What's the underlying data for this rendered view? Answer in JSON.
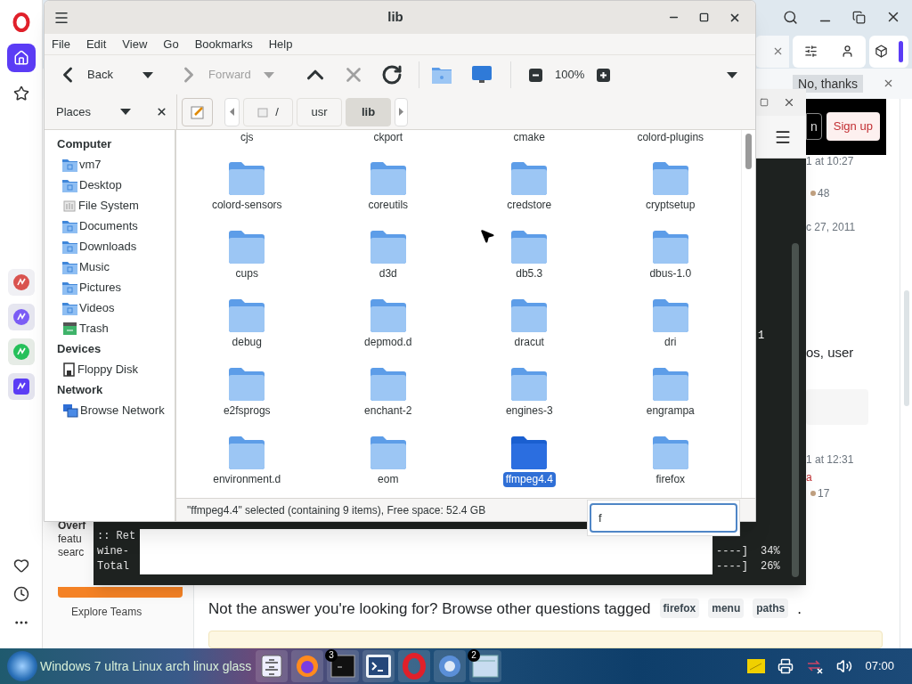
{
  "browser": {
    "sidebar_top": [
      {
        "kind": "opera",
        "selected": false
      },
      {
        "kind": "home",
        "selected": true
      },
      {
        "kind": "star",
        "selected": false
      }
    ],
    "sidebar_apps": [
      {
        "kind": "paint"
      },
      {
        "kind": "messenger"
      },
      {
        "kind": "whatsapp"
      },
      {
        "kind": "music"
      }
    ],
    "sidebar_bottom": [
      {
        "kind": "heart"
      },
      {
        "kind": "clock"
      },
      {
        "kind": "more"
      }
    ],
    "popup": {
      "button": "No, thanks"
    },
    "header": {
      "login_fragment": "n",
      "signup": "Sign up"
    },
    "left_column": {
      "lines": [
        "Overf",
        "featu",
        "searc"
      ],
      "link": "Explore Teams"
    },
    "question": {
      "text": "Not the answer you're looking for? Browse other questions tagged",
      "tags": [
        "firefox",
        "menu",
        "paths"
      ],
      "end": "."
    },
    "right_column": {
      "time_1": "1 at 10:27",
      "score_1": "48",
      "date": "c 27, 2011",
      "snippet": "os, user",
      "time_2": "1 at 12:31",
      "author_2": "a",
      "score_2": "17"
    }
  },
  "terminal": {
    "fragment": "1",
    "rows": [
      {
        "left": ":: Ret"
      },
      {
        "left": "wine-",
        "bar": "----]",
        "percent": "34%"
      },
      {
        "left": "Total",
        "bar": "----]",
        "percent": "26%"
      }
    ]
  },
  "file_manager": {
    "title": "lib",
    "menu": [
      "File",
      "Edit",
      "View",
      "Go",
      "Bookmarks",
      "Help"
    ],
    "nav": [
      {
        "kind": "back",
        "label": "Back",
        "disabled": false
      },
      {
        "kind": "forward",
        "label": "Forward",
        "disabled": true
      }
    ],
    "tools": [
      {
        "kind": "up",
        "disabled": false
      },
      {
        "kind": "stop",
        "disabled": true
      },
      {
        "kind": "reload",
        "disabled": false
      }
    ],
    "zoom": "100%",
    "places": "Places",
    "path": [
      {
        "label": "/",
        "kind": "root",
        "selected": false
      },
      {
        "label": "usr",
        "kind": "dir",
        "selected": false
      },
      {
        "label": "lib",
        "kind": "dir",
        "selected": true
      }
    ],
    "sidebar": [
      {
        "heading": "Computer",
        "items": [
          {
            "label": "vm7",
            "kind": "home"
          },
          {
            "label": "Desktop",
            "kind": "desktop"
          },
          {
            "label": "File System",
            "kind": "drive"
          },
          {
            "label": "Documents",
            "kind": "documents"
          },
          {
            "label": "Downloads",
            "kind": "downloads"
          },
          {
            "label": "Music",
            "kind": "music"
          },
          {
            "label": "Pictures",
            "kind": "pictures"
          },
          {
            "label": "Videos",
            "kind": "videos"
          },
          {
            "label": "Trash",
            "kind": "trash"
          }
        ]
      },
      {
        "heading": "Devices",
        "items": [
          {
            "label": "Floppy Disk",
            "kind": "floppy"
          }
        ]
      },
      {
        "heading": "Network",
        "items": [
          {
            "label": "Browse Network",
            "kind": "network"
          }
        ]
      }
    ],
    "files": [
      {
        "name": "cjs",
        "kind": "label",
        "selected": false
      },
      {
        "name": "ckport",
        "kind": "label",
        "selected": false
      },
      {
        "name": "cmake",
        "kind": "label",
        "selected": false
      },
      {
        "name": "colord-plugins",
        "kind": "label",
        "selected": false
      },
      {
        "name": "colord-sensors",
        "kind": "folder",
        "selected": false
      },
      {
        "name": "coreutils",
        "kind": "folder",
        "selected": false
      },
      {
        "name": "credstore",
        "kind": "folder",
        "selected": false
      },
      {
        "name": "cryptsetup",
        "kind": "folder",
        "selected": false
      },
      {
        "name": "cups",
        "kind": "folder",
        "selected": false
      },
      {
        "name": "d3d",
        "kind": "folder",
        "selected": false
      },
      {
        "name": "db5.3",
        "kind": "folder",
        "selected": false
      },
      {
        "name": "dbus-1.0",
        "kind": "folder",
        "selected": false
      },
      {
        "name": "debug",
        "kind": "folder",
        "selected": false
      },
      {
        "name": "depmod.d",
        "kind": "folder",
        "selected": false
      },
      {
        "name": "dracut",
        "kind": "folder",
        "selected": false
      },
      {
        "name": "dri",
        "kind": "folder",
        "selected": false
      },
      {
        "name": "e2fsprogs",
        "kind": "folder",
        "selected": false
      },
      {
        "name": "enchant-2",
        "kind": "folder",
        "selected": false
      },
      {
        "name": "engines-3",
        "kind": "folder",
        "selected": false
      },
      {
        "name": "engrampa",
        "kind": "folder",
        "selected": false
      },
      {
        "name": "environment.d",
        "kind": "folder",
        "selected": false
      },
      {
        "name": "eom",
        "kind": "folder",
        "selected": false
      },
      {
        "name": "ffmpeg4.4",
        "kind": "folder",
        "selected": true
      },
      {
        "name": "firefox",
        "kind": "folder",
        "selected": false
      }
    ],
    "status": "\"ffmpeg4.4\" selected (containing 9 items), Free space: 52.4 GB",
    "typeahead": {
      "value": "f"
    }
  },
  "taskbar": {
    "start_label": "Windows 7 ultra Linux arch linux glass",
    "apps": [
      {
        "kind": "files"
      },
      {
        "kind": "firefox"
      },
      {
        "kind": "terminal",
        "badge": "3"
      },
      {
        "kind": "prompt"
      },
      {
        "kind": "opera"
      },
      {
        "kind": "chromium"
      },
      {
        "kind": "folder",
        "badge": "2"
      }
    ],
    "tray": [
      {
        "kind": "note"
      },
      {
        "kind": "printer"
      },
      {
        "kind": "network"
      },
      {
        "kind": "volume"
      }
    ],
    "clock": "07:00"
  }
}
